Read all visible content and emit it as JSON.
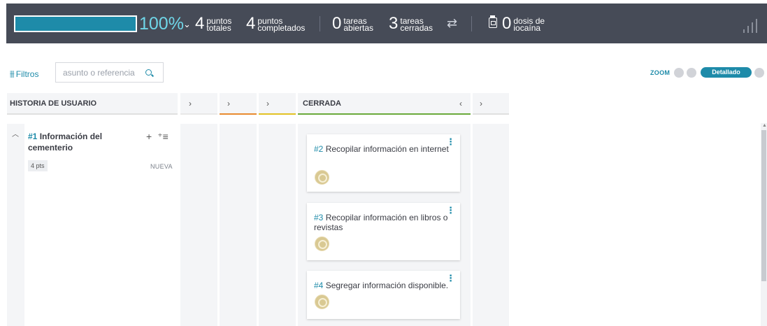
{
  "stats": {
    "progress": 1.0,
    "progress_label": "100%",
    "total_points": {
      "value": "4",
      "label": "puntos\ntotales"
    },
    "completed_points": {
      "value": "4",
      "label": "puntos\ncompletados"
    },
    "open_tasks": {
      "value": "0",
      "label": "tareas\nabiertas"
    },
    "closed_tasks": {
      "value": "3",
      "label": "tareas\ncerradas"
    },
    "iocaine": {
      "value": "0",
      "label": "dosis de\niocaína"
    }
  },
  "toolbar": {
    "filters_label": "Filtros",
    "search_placeholder": "asunto o referencia",
    "zoom_label": "ZOOM",
    "zoom_selected": "Detallado"
  },
  "board": {
    "story_column_title": "HISTORIA DE USUARIO",
    "collapsed_arrow": "›",
    "expanded_column_title": "CERRADA",
    "collapse_arrow": "‹",
    "status_colors": [
      "#e8e8e8",
      "#e88a2f",
      "#e2c224",
      "#6aa93b",
      "#e0e0e0"
    ]
  },
  "story": {
    "ref": "#1",
    "title": "Información del cementerio",
    "points": "4 pts",
    "status": "NUEVA"
  },
  "tasks": [
    {
      "ref": "#2",
      "title": "Recopilar información en internet"
    },
    {
      "ref": "#3",
      "title": "Recopilar información en libros o revistas"
    },
    {
      "ref": "#4",
      "title": "Segregar información disponible."
    }
  ]
}
